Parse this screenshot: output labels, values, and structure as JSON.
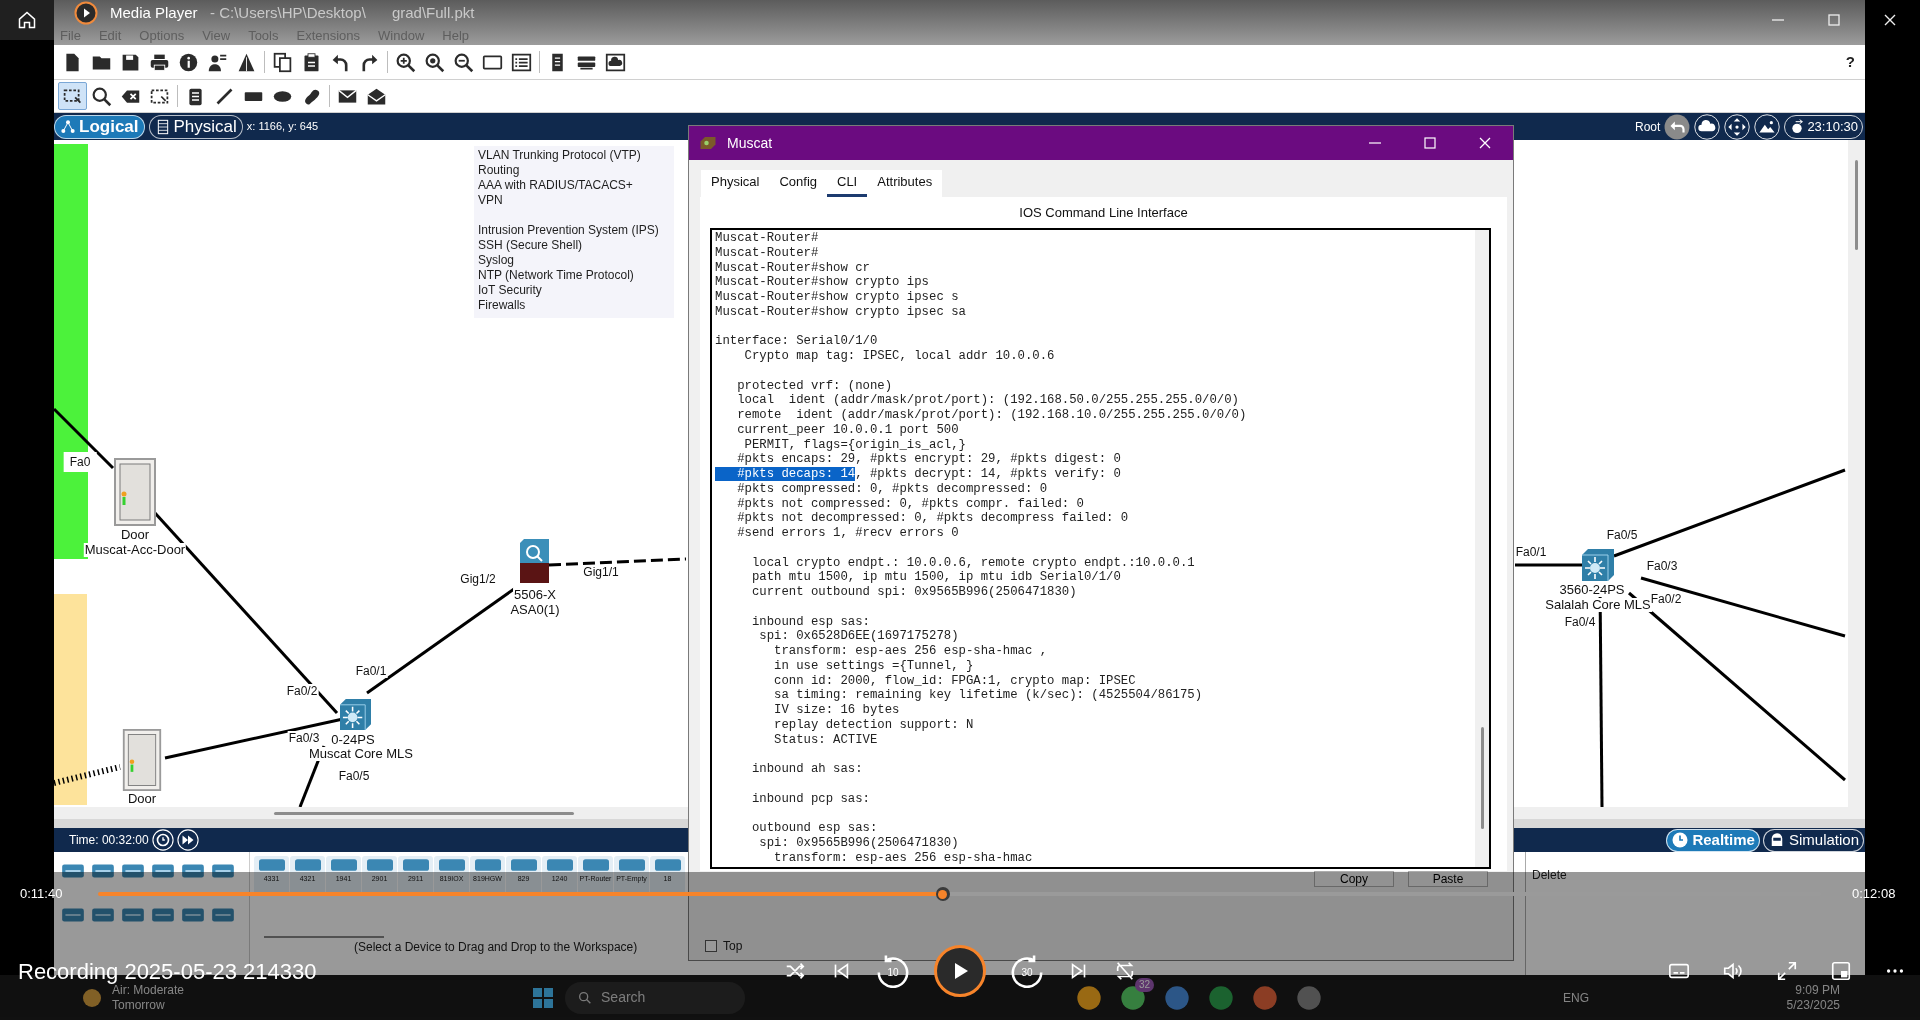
{
  "media_player": {
    "app_name": "Media Player",
    "title": "Recording 2025-05-23 214330",
    "elapsed": "0:11:40",
    "duration": "0:12:08",
    "progress": {
      "level": 0.49
    },
    "playing": false,
    "rewind_label": "10",
    "forward_label": "30"
  },
  "packet_tracer": {
    "title_parts": [
      "- C:\\Users\\HP\\Desktop\\",
      "grad\\Full.pkt"
    ],
    "menu": [
      "File",
      "Edit",
      "Options",
      "View",
      "Tools",
      "Extensions",
      "Window",
      "Help"
    ],
    "help": "?",
    "view_tabs": [
      {
        "label": "Logical",
        "selected": true
      },
      {
        "label": "Physical",
        "selected": false
      }
    ],
    "cursor": "x: 1166, y: 645",
    "path": "Root",
    "clock": "23:10:30",
    "notes": [
      [
        "VLAN Trunking Protocol (VTP)",
        "Routing",
        "AAA with RADIUS/TACACS+",
        "VPN"
      ],
      [
        "Intrusion Prevention System (IPS)",
        "SSH (Secure Shell)",
        "Syslog",
        "NTP (Network Time Protocol)",
        "IoT Security",
        "Firewalls"
      ]
    ],
    "devices": [
      {
        "kind": "door",
        "labels": [
          "Door",
          "Muscat-Acc-Door"
        ]
      },
      {
        "kind": "door",
        "labels": [
          "Door"
        ]
      },
      {
        "kind": "switch",
        "labels": [
          "0-24PS",
          "Muscat Core MLS"
        ]
      },
      {
        "kind": "firewall",
        "labels": [
          "5506-X",
          "ASA0(1)"
        ]
      },
      {
        "kind": "switch",
        "labels": [
          "3560-24PS",
          "Salalah Core MLS"
        ]
      }
    ],
    "ports": [
      "Fa0",
      "Fa0/2",
      "Fa0/1",
      "Fa0/3",
      "Fa0/5",
      "Gig1/2",
      "Gig1/1",
      "Fa0/1",
      "Fa0/5",
      "Fa0/3",
      "Fa0/2",
      "Fa0/4"
    ],
    "time": "Time: 00:32:00",
    "modes": [
      {
        "label": "Realtime",
        "selected": true
      },
      {
        "label": "Simulation",
        "selected": false
      }
    ],
    "device_models": [
      "4331",
      "4321",
      "1941",
      "2901",
      "2911",
      "819IOX",
      "819HGW",
      "829",
      "1240",
      "PT-Router",
      "PT-Empty",
      "18"
    ],
    "hint": "(Select a Device to Drag and Drop to the Workspace)",
    "delete_label": "Delete"
  },
  "device_window": {
    "title": "Muscat",
    "tabs": [
      {
        "label": "Physical",
        "selected": false
      },
      {
        "label": "Config",
        "selected": false
      },
      {
        "label": "CLI",
        "selected": true
      },
      {
        "label": "Attributes",
        "selected": false
      }
    ],
    "heading": "IOS Command Line Interface",
    "cli_paragraphs": [
      [
        "Muscat-Router#",
        "Muscat-Router#",
        "Muscat-Router#show cr",
        "Muscat-Router#show crypto ips",
        "Muscat-Router#show crypto ipsec s",
        "Muscat-Router#show crypto ipsec sa"
      ],
      [
        "interface: Serial0/1/0",
        "    Crypto map tag: IPSEC, local addr 10.0.0.6"
      ],
      [
        "   protected vrf: (none)",
        "   local  ident (addr/mask/prot/port): (192.168.50.0/255.255.255.0/0/0)",
        "   remote  ident (addr/mask/prot/port): (192.168.10.0/255.255.255.0/0/0)",
        "   current_peer 10.0.0.1 port 500",
        "    PERMIT, flags={origin_is_acl,}",
        "   #pkts encaps: 29, #pkts encrypt: 29, #pkts digest: 0",
        {
          "segments": [
            {
              "text": "   #pkts decaps: 14",
              "selected": true
            },
            {
              "text": ", #pkts decrypt: 14, #pkts verify: 0",
              "selected": false
            }
          ]
        },
        "   #pkts compressed: 0, #pkts decompressed: 0",
        "   #pkts not compressed: 0, #pkts compr. failed: 0",
        "   #pkts not decompressed: 0, #pkts decompress failed: 0",
        "   #send errors 1, #recv errors 0"
      ],
      [
        "     local crypto endpt.: 10.0.0.6, remote crypto endpt.:10.0.0.1",
        "     path mtu 1500, ip mtu 1500, ip mtu idb Serial0/1/0",
        "     current outbound spi: 0x9565B996(2506471830)"
      ],
      [
        "     inbound esp sas:",
        "      spi: 0x6528D6EE(1697175278)",
        "        transform: esp-aes 256 esp-sha-hmac ,",
        "        in use settings ={Tunnel, }",
        "        conn id: 2000, flow_id: FPGA:1, crypto map: IPSEC",
        "        sa timing: remaining key lifetime (k/sec): (4525504/86175)",
        "        IV size: 16 bytes",
        "        replay detection support: N",
        "        Status: ACTIVE"
      ],
      [
        "     inbound ah sas:"
      ],
      [
        "     inbound pcp sas:"
      ],
      [
        "     outbound esp sas:",
        "      spi: 0x9565B996(2506471830)",
        "        transform: esp-aes 256 esp-sha-hmac"
      ]
    ],
    "buttons": [
      "Copy",
      "Paste"
    ],
    "top": {
      "label": "Top",
      "checked": false
    }
  },
  "taskbar": {
    "weather": [
      "Air: Moderate",
      "Tomorrow"
    ],
    "search": "Search",
    "badge": "32",
    "language": "ENG",
    "time": "9:09 PM",
    "date": "5/23/2025"
  }
}
